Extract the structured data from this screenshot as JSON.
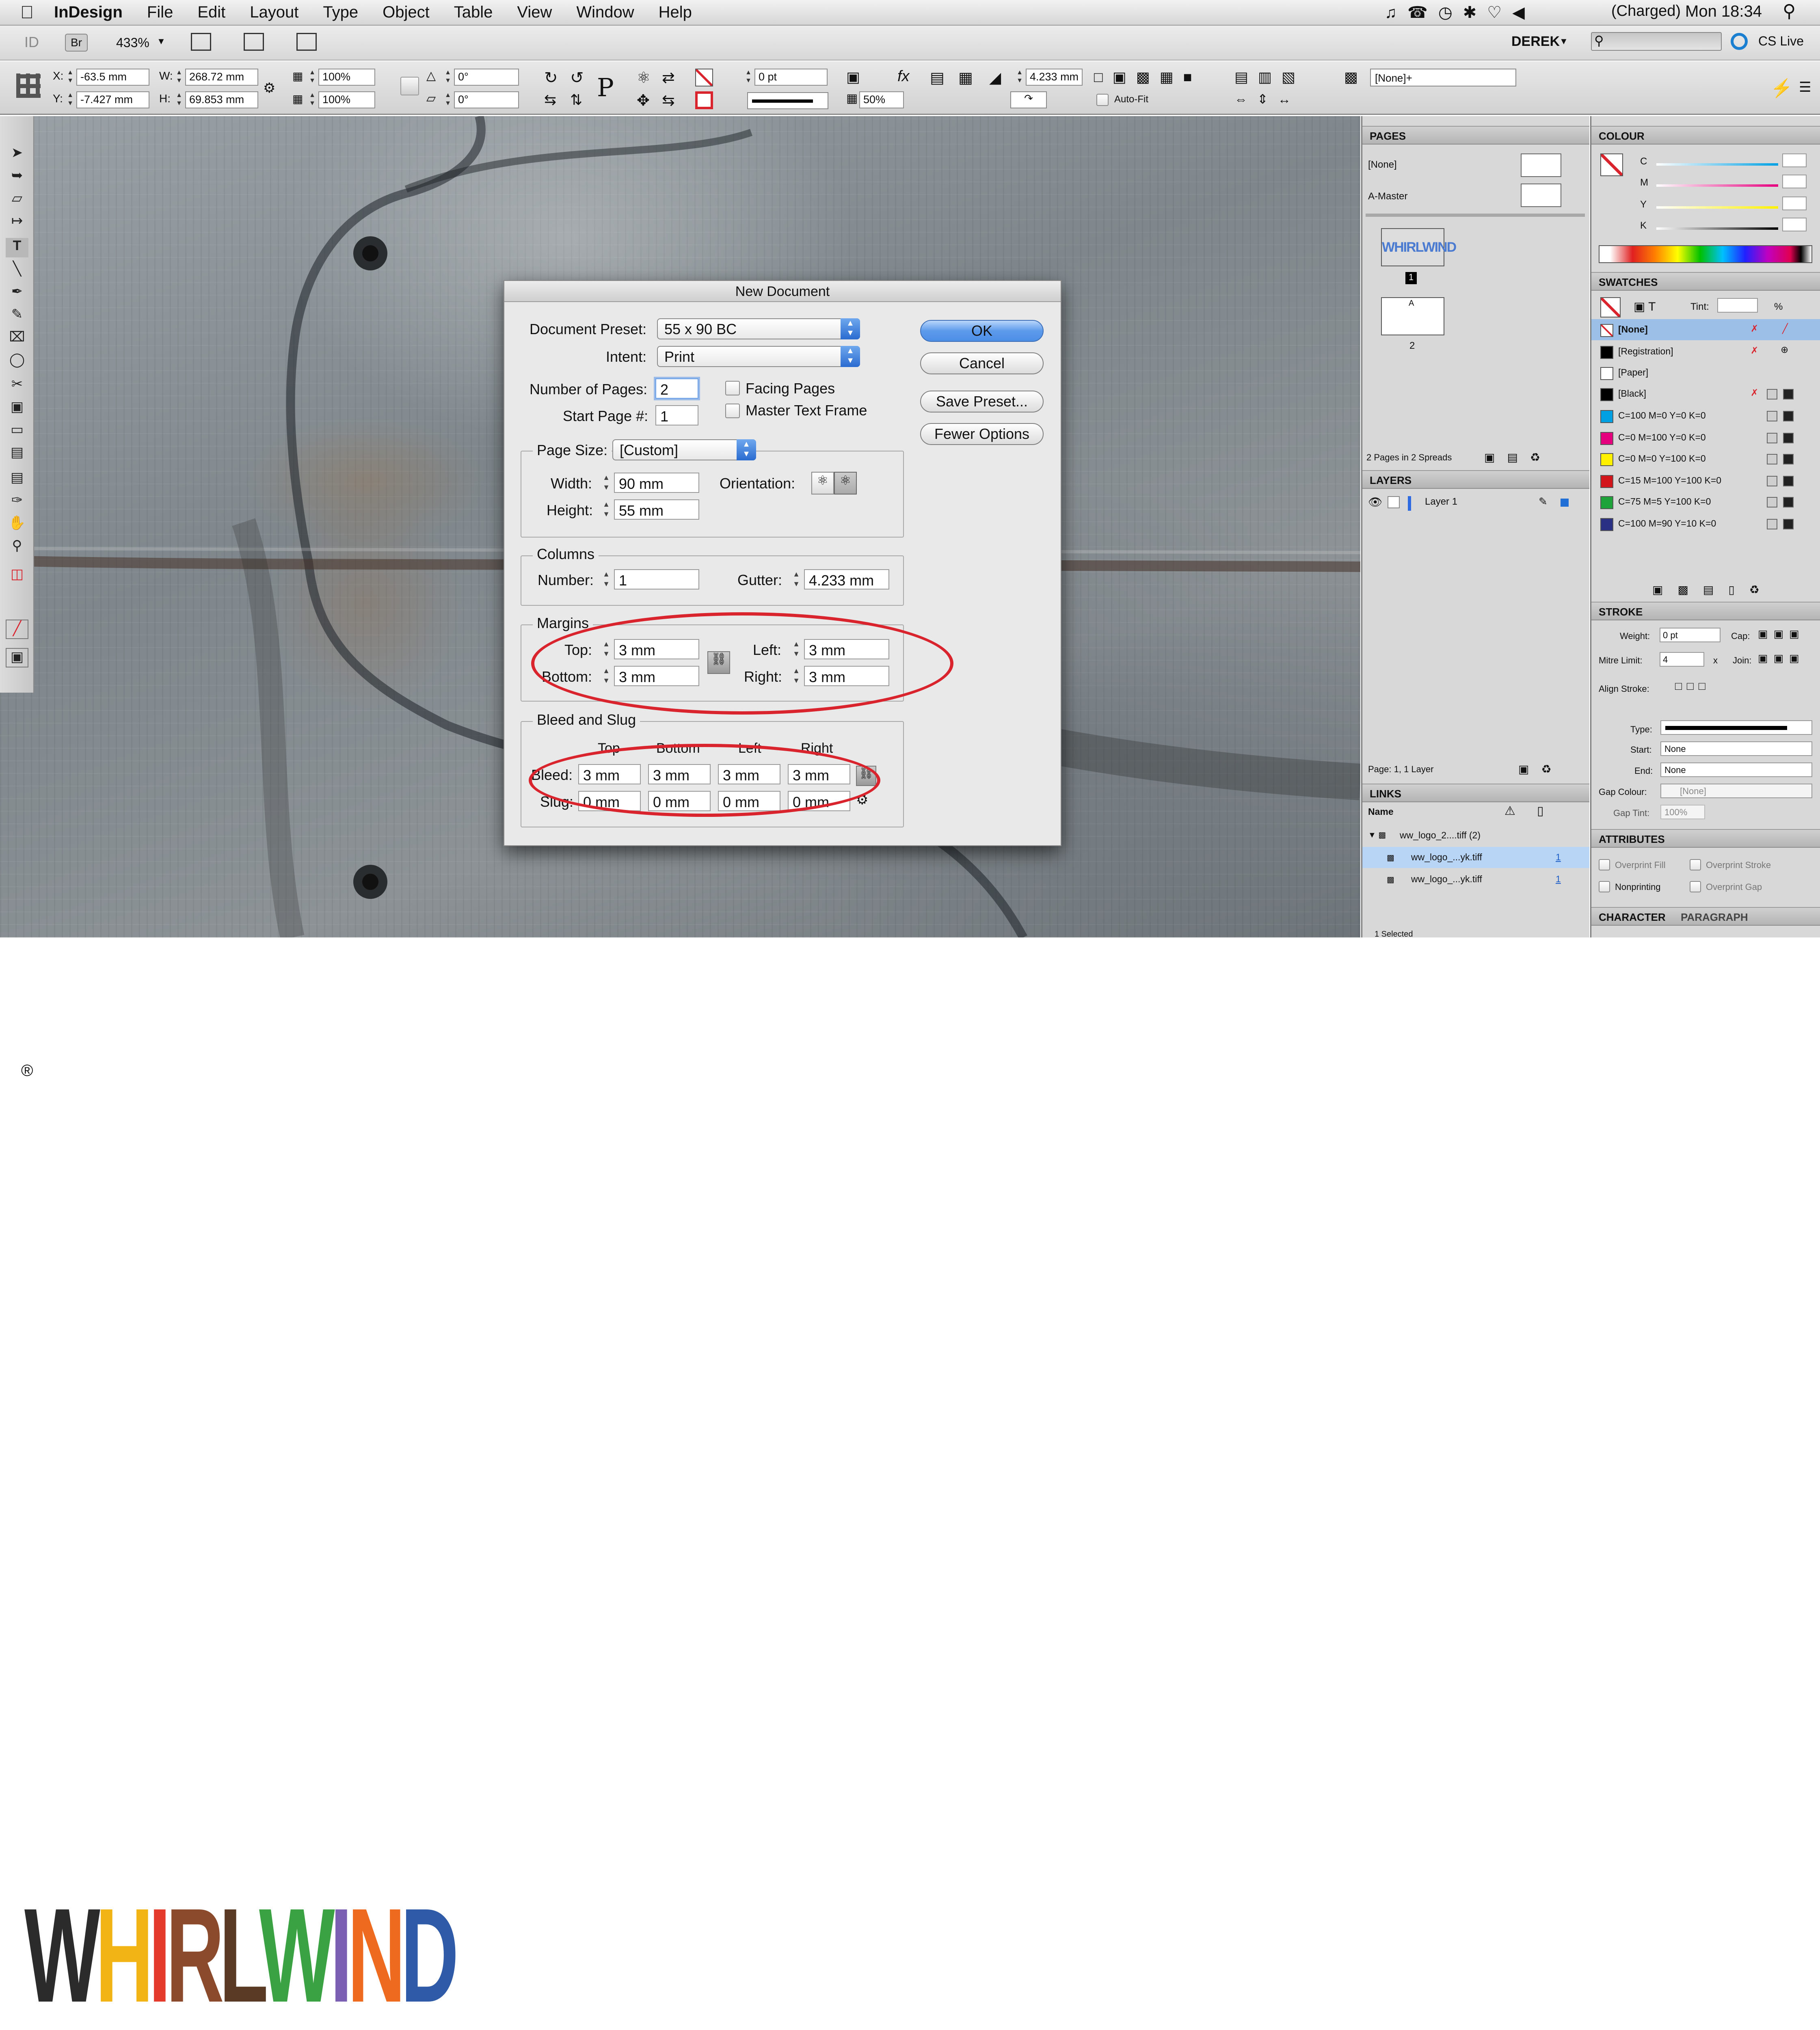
{
  "menubar": {
    "app": "InDesign",
    "items": [
      "File",
      "Edit",
      "Layout",
      "Type",
      "Object",
      "Table",
      "View",
      "Window",
      "Help"
    ],
    "status": "(Charged)",
    "clock": "Mon 18:34"
  },
  "appbar": {
    "app_badge": "ID",
    "bridge": "Br",
    "zoom": "433%",
    "workspace": "DEREK",
    "cslive": "CS Live"
  },
  "control": {
    "x": "-63.5 mm",
    "y": "-7.427 mm",
    "w": "268.72 mm",
    "h": "69.853 mm",
    "scale_x": "100%",
    "scale_y": "100%",
    "rotate": "0°",
    "shear": "0°",
    "stroke_weight": "0 pt",
    "opacity": "50%",
    "gutter": "4.233 mm",
    "autofit": "Auto-Fit",
    "style": "[None]+"
  },
  "dialog": {
    "title": "New Document",
    "preset_label": "Document Preset:",
    "preset": "55 x 90 BC",
    "intent_label": "Intent:",
    "intent": "Print",
    "pages_label": "Number of Pages:",
    "pages": "2",
    "start_label": "Start Page #:",
    "start": "1",
    "facing": "Facing Pages",
    "master": "Master Text Frame",
    "pagesize_label": "Page Size:",
    "pagesize": "[Custom]",
    "width_label": "Width:",
    "width": "90 mm",
    "height_label": "Height:",
    "height": "55 mm",
    "orientation_label": "Orientation:",
    "columns_title": "Columns",
    "number_label": "Number:",
    "number": "1",
    "gutter_label": "Gutter:",
    "gutter": "4.233 mm",
    "margins_title": "Margins",
    "top_label": "Top:",
    "top": "3 mm",
    "bottom_label": "Bottom:",
    "bottom": "3 mm",
    "left_label": "Left:",
    "left": "3 mm",
    "right_label": "Right:",
    "right": "3 mm",
    "bleed_title": "Bleed and Slug",
    "col_top": "Top",
    "col_bottom": "Bottom",
    "col_left": "Left",
    "col_right": "Right",
    "bleed_label": "Bleed:",
    "bleed": [
      "3 mm",
      "3 mm",
      "3 mm",
      "3 mm"
    ],
    "slug_label": "Slug:",
    "slug": [
      "0 mm",
      "0 mm",
      "0 mm",
      "0 mm"
    ],
    "ok": "OK",
    "cancel": "Cancel",
    "save": "Save Preset...",
    "fewer": "Fewer Options"
  },
  "pages_panel": {
    "title": "PAGES",
    "none": "[None]",
    "amaster": "A-Master",
    "thumb_logo": "WHIRLWIND",
    "p1": "1",
    "p2": "2",
    "a": "A",
    "footer": "2 Pages in 2 Spreads"
  },
  "layers_panel": {
    "title": "LAYERS",
    "layer": "Layer 1",
    "footer": "Page: 1, 1 Layer"
  },
  "links_panel": {
    "title": "LINKS",
    "name_col": "Name",
    "rows": [
      "ww_logo_2....tiff (2)",
      "ww_logo_...yk.tiff",
      "ww_logo_...yk.tiff"
    ],
    "page": "1",
    "footer": "1 Selected"
  },
  "colour_panel": {
    "title": "COLOUR",
    "channels": [
      "C",
      "M",
      "Y",
      "K"
    ],
    "pct": "%"
  },
  "swatches_panel": {
    "title": "SWATCHES",
    "tint": "Tint:",
    "pct": "%",
    "items": [
      {
        "name": "[None]",
        "color": "#ffffff"
      },
      {
        "name": "[Registration]",
        "color": "#000000"
      },
      {
        "name": "[Paper]",
        "color": "#ffffff"
      },
      {
        "name": "[Black]",
        "color": "#000000"
      },
      {
        "name": "C=100 M=0 Y=0 K=0",
        "color": "#00a0e3"
      },
      {
        "name": "C=0 M=100 Y=0 K=0",
        "color": "#e5007e"
      },
      {
        "name": "C=0 M=0 Y=100 K=0",
        "color": "#fff100"
      },
      {
        "name": "C=15 M=100 Y=100 K=0",
        "color": "#d2141b"
      },
      {
        "name": "C=75 M=5 Y=100 K=0",
        "color": "#1ea23a"
      },
      {
        "name": "C=100 M=90 Y=10 K=0",
        "color": "#2a3185"
      }
    ]
  },
  "stroke_panel": {
    "title": "STROKE",
    "weight_label": "Weight:",
    "weight": "0 pt",
    "cap": "Cap:",
    "miter_label": "Mitre Limit:",
    "miter": "4",
    "x": "x",
    "join": "Join:",
    "align": "Align Stroke:",
    "type_label": "Type:",
    "start_label": "Start:",
    "start": "None",
    "end_label": "End:",
    "end": "None",
    "gapc_label": "Gap Colour:",
    "gapc": "[None]",
    "gapt_label": "Gap Tint:",
    "gapt": "100%"
  },
  "attributes_panel": {
    "title": "ATTRIBUTES",
    "opts": [
      "Overprint Fill",
      "Overprint Stroke",
      "Nonprinting",
      "Overprint Gap"
    ]
  },
  "character_panel": {
    "tab1": "CHARACTER",
    "tab2": "PARAGRAPH"
  },
  "logo": {
    "letters": [
      "W",
      "H",
      "I",
      "R",
      "L",
      "W",
      "I",
      "N",
      "D"
    ],
    "colors": [
      "#2b2b2b",
      "#f2b315",
      "#e33a2c",
      "#8b4a2b",
      "#5a3a24",
      "#3ba244",
      "#7b5fb2",
      "#ee6a1f",
      "#2e5aa8"
    ],
    "reg": "®"
  }
}
